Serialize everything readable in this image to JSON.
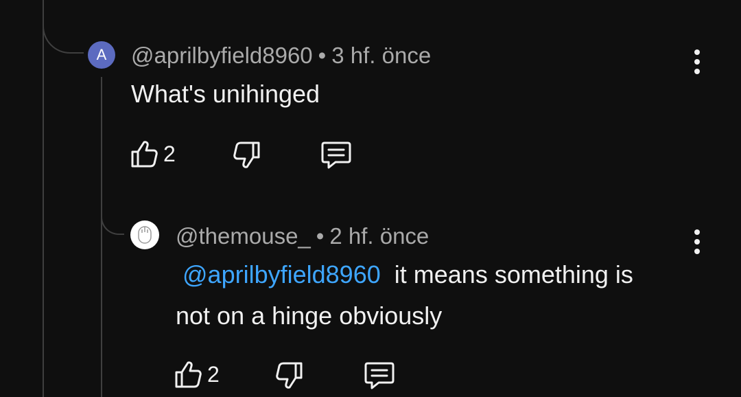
{
  "comments": [
    {
      "avatar_letter": "A",
      "avatar_color": "#5c6bc0",
      "handle": "@aprilbyfield8960",
      "time": "3 hf. önce",
      "separator": "•",
      "text": "What's unihinged",
      "like_count": "2",
      "icons": [
        "thumbs-up-icon",
        "thumbs-down-icon",
        "reply-icon",
        "more-vert-icon"
      ]
    },
    {
      "avatar_icon": "mouse-icon",
      "handle": "@themouse_",
      "time": "2 hf. önce",
      "separator": "•",
      "mention": "@aprilbyfield8960",
      "text_line1": "it means something is",
      "text_line2": "not on a hinge obviously",
      "like_count": "2",
      "mention_color": "#3ea6ff",
      "icons": [
        "thumbs-up-icon",
        "thumbs-down-icon",
        "reply-icon",
        "more-vert-icon"
      ]
    }
  ]
}
